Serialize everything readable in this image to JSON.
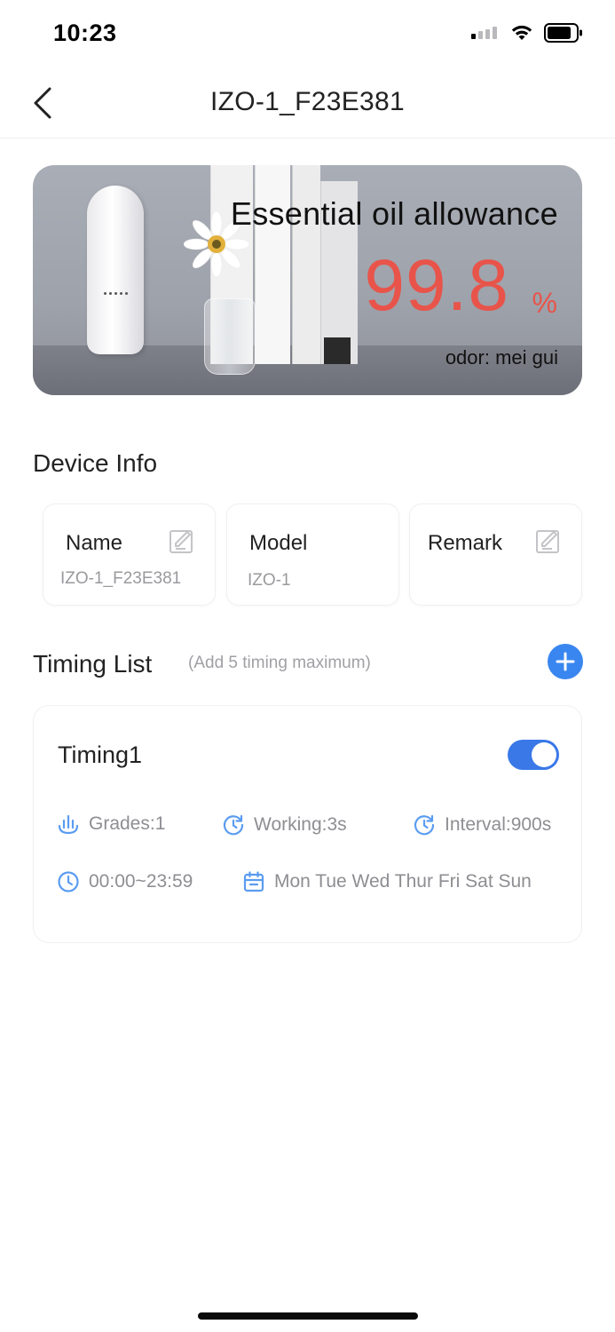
{
  "status_bar": {
    "time": "10:23"
  },
  "nav": {
    "title": "IZO-1_F23E381"
  },
  "banner": {
    "title": "Essential oil allowance",
    "value": "99.8",
    "unit": "%",
    "odor": "odor: mei gui",
    "value_color": "#e8544a"
  },
  "device_info": {
    "heading": "Device Info",
    "cards": [
      {
        "label": "Name",
        "value": "IZO-1_F23E381",
        "editable": true
      },
      {
        "label": "Model",
        "value": "IZO-1",
        "editable": false
      },
      {
        "label": "Remark",
        "value": "",
        "editable": true
      }
    ]
  },
  "timing_list": {
    "heading": "Timing List",
    "hint": "(Add 5 timing maximum)",
    "items": [
      {
        "name": "Timing1",
        "enabled": true,
        "grades": "Grades:1",
        "working": "Working:3s",
        "interval": "Interval:900s",
        "time_range": "00:00~23:59",
        "days": "Mon Tue Wed Thur Fri Sat Sun"
      }
    ]
  },
  "colors": {
    "accent": "#3a86f0",
    "toggle_on": "#3a78e8",
    "icon": "#5b9cf0"
  }
}
